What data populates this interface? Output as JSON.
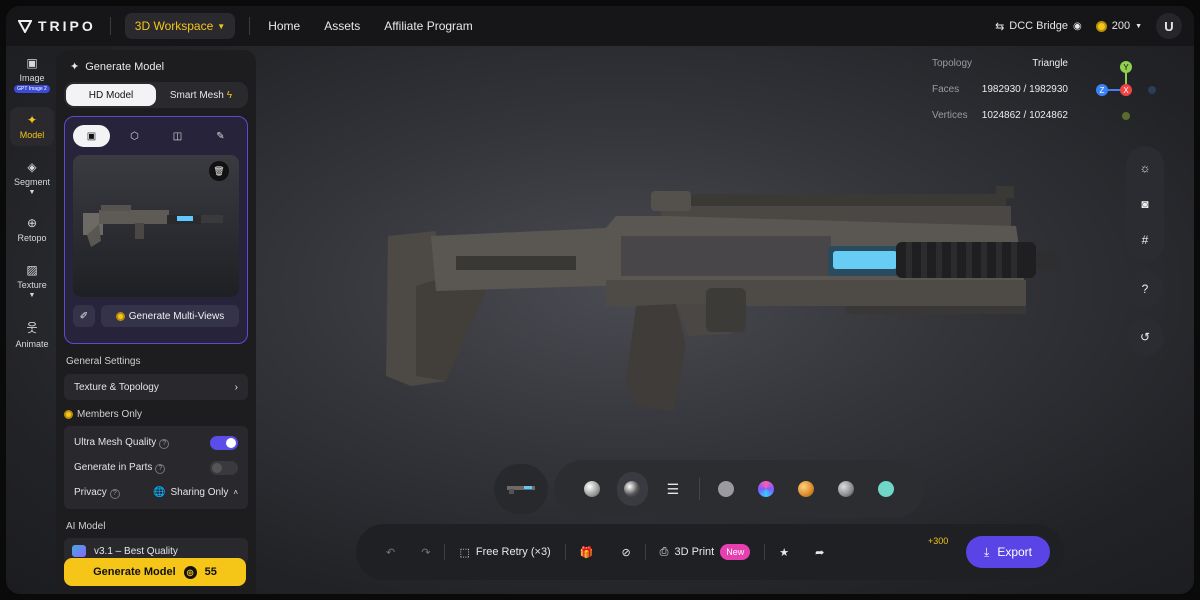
{
  "topbar": {
    "brand": "TRIPO",
    "workspace_label": "3D Workspace",
    "nav": [
      "Home",
      "Assets",
      "Affiliate Program"
    ],
    "dcc_bridge": "DCC Bridge",
    "credits": "200",
    "avatar_initial": "U"
  },
  "rail": {
    "items": [
      {
        "label": "Image",
        "icon": "image-icon",
        "badge": "GPT Image 2"
      },
      {
        "label": "Model",
        "icon": "sparkle-icon"
      },
      {
        "label": "Segment",
        "icon": "cube-icon"
      },
      {
        "label": "Retopo",
        "icon": "globe-mesh-icon"
      },
      {
        "label": "Texture",
        "icon": "hatch-icon"
      },
      {
        "label": "Animate",
        "icon": "figure-icon"
      }
    ]
  },
  "panel": {
    "title": "Generate Model",
    "mode_tabs": [
      "HD Model",
      "Smart Mesh"
    ],
    "generate_multiviews": "Generate Multi-Views",
    "general_settings": "General Settings",
    "texture_topology": "Texture & Topology",
    "members_only": "Members Only",
    "ultra_mesh_quality": "Ultra Mesh Quality",
    "generate_in_parts": "Generate in Parts",
    "privacy": "Privacy",
    "sharing_only": "Sharing Only",
    "ai_model_heading": "AI Model",
    "ai_model_value": "v3.1 – Best Quality",
    "generate_button": "Generate Model",
    "generate_cost": "55",
    "ultra_mesh_enabled": true,
    "generate_in_parts_enabled": false
  },
  "stats": {
    "topology_label": "Topology",
    "topology_value": "Triangle",
    "faces_label": "Faces",
    "faces_value": "1982930 / 1982930",
    "vertices_label": "Vertices",
    "vertices_value": "1024862 / 1024862"
  },
  "axes": {
    "y": "Y",
    "z": "Z",
    "x": "X"
  },
  "materials": {
    "colors": [
      "#9a9aa0",
      "#7a5cff",
      "#d98a2a",
      "#8a8a90",
      "#6fd6c8"
    ]
  },
  "bottombar": {
    "free_retry": "Free Retry (×3)",
    "print_3d": "3D Print",
    "new_badge": "New",
    "plus300": "+300",
    "export": "Export"
  }
}
